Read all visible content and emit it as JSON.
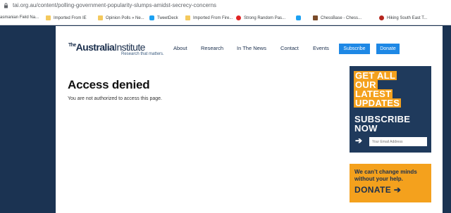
{
  "browser": {
    "url": "tai.org.au/content/polling-government-popularity-slumps-amidst-secrecy-concerns",
    "bookmarks": [
      {
        "label": "asmanian Field Na...",
        "icon": "folder-icon"
      },
      {
        "label": "Imported From IE",
        "icon": "folder-icon"
      },
      {
        "label": "Opinion Polls » Ne...",
        "icon": "folder-icon"
      },
      {
        "label": "TweetDeck",
        "icon": "twitter-icon"
      },
      {
        "label": "Imported From Fire...",
        "icon": "folder-icon"
      },
      {
        "label": "Strong Random Pas...",
        "icon": "password-icon"
      },
      {
        "label": "",
        "icon": "twitter-icon"
      },
      {
        "label": "ChessBase - Chess...",
        "icon": "chessbase-icon"
      },
      {
        "label": "Hiking South East T...",
        "icon": "hiking-icon"
      }
    ]
  },
  "header": {
    "logo_the": "The",
    "logo_australia": "Australia",
    "logo_institute": "Institute",
    "logo_tagline": "Research that matters.",
    "nav": [
      "About",
      "Research",
      "In The News",
      "Contact",
      "Events"
    ],
    "subscribe_label": "Subscribe",
    "donate_label": "Donate"
  },
  "main": {
    "heading": "Access denied",
    "message": "You are not authorized to access this page."
  },
  "sidebar": {
    "subscribe_lines": [
      "GET ALL",
      "OUR",
      "LATEST",
      "UPDATES"
    ],
    "subscribe_line1": "SUBSCRIBE",
    "subscribe_line2": "NOW",
    "email_placeholder": "Your Email Address",
    "donate_text": "We can’t change minds without your help.",
    "donate_cta": "DONATE"
  },
  "colors": {
    "navy": "#1b3352",
    "orange": "#f4a11d",
    "button_blue": "#1e88e5"
  }
}
